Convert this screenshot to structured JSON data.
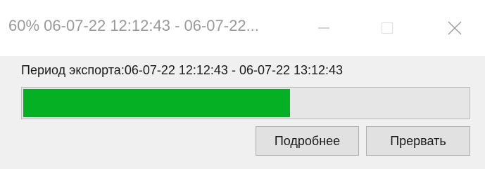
{
  "window": {
    "title": "60% 06-07-22 12:12:43 - 06-07-22...",
    "controls": {
      "minimize_icon": "minimize-icon",
      "maximize_icon": "maximize-icon",
      "close_icon": "close-icon"
    }
  },
  "dialog": {
    "period_text": "Период экспорта:06-07-22 12:12:43 - 06-07-22 13:12:43",
    "progress": {
      "value_percent": 60,
      "fill_color": "#06b025"
    },
    "buttons": {
      "details_label": "Подробнее",
      "abort_label": "Прервать"
    }
  }
}
